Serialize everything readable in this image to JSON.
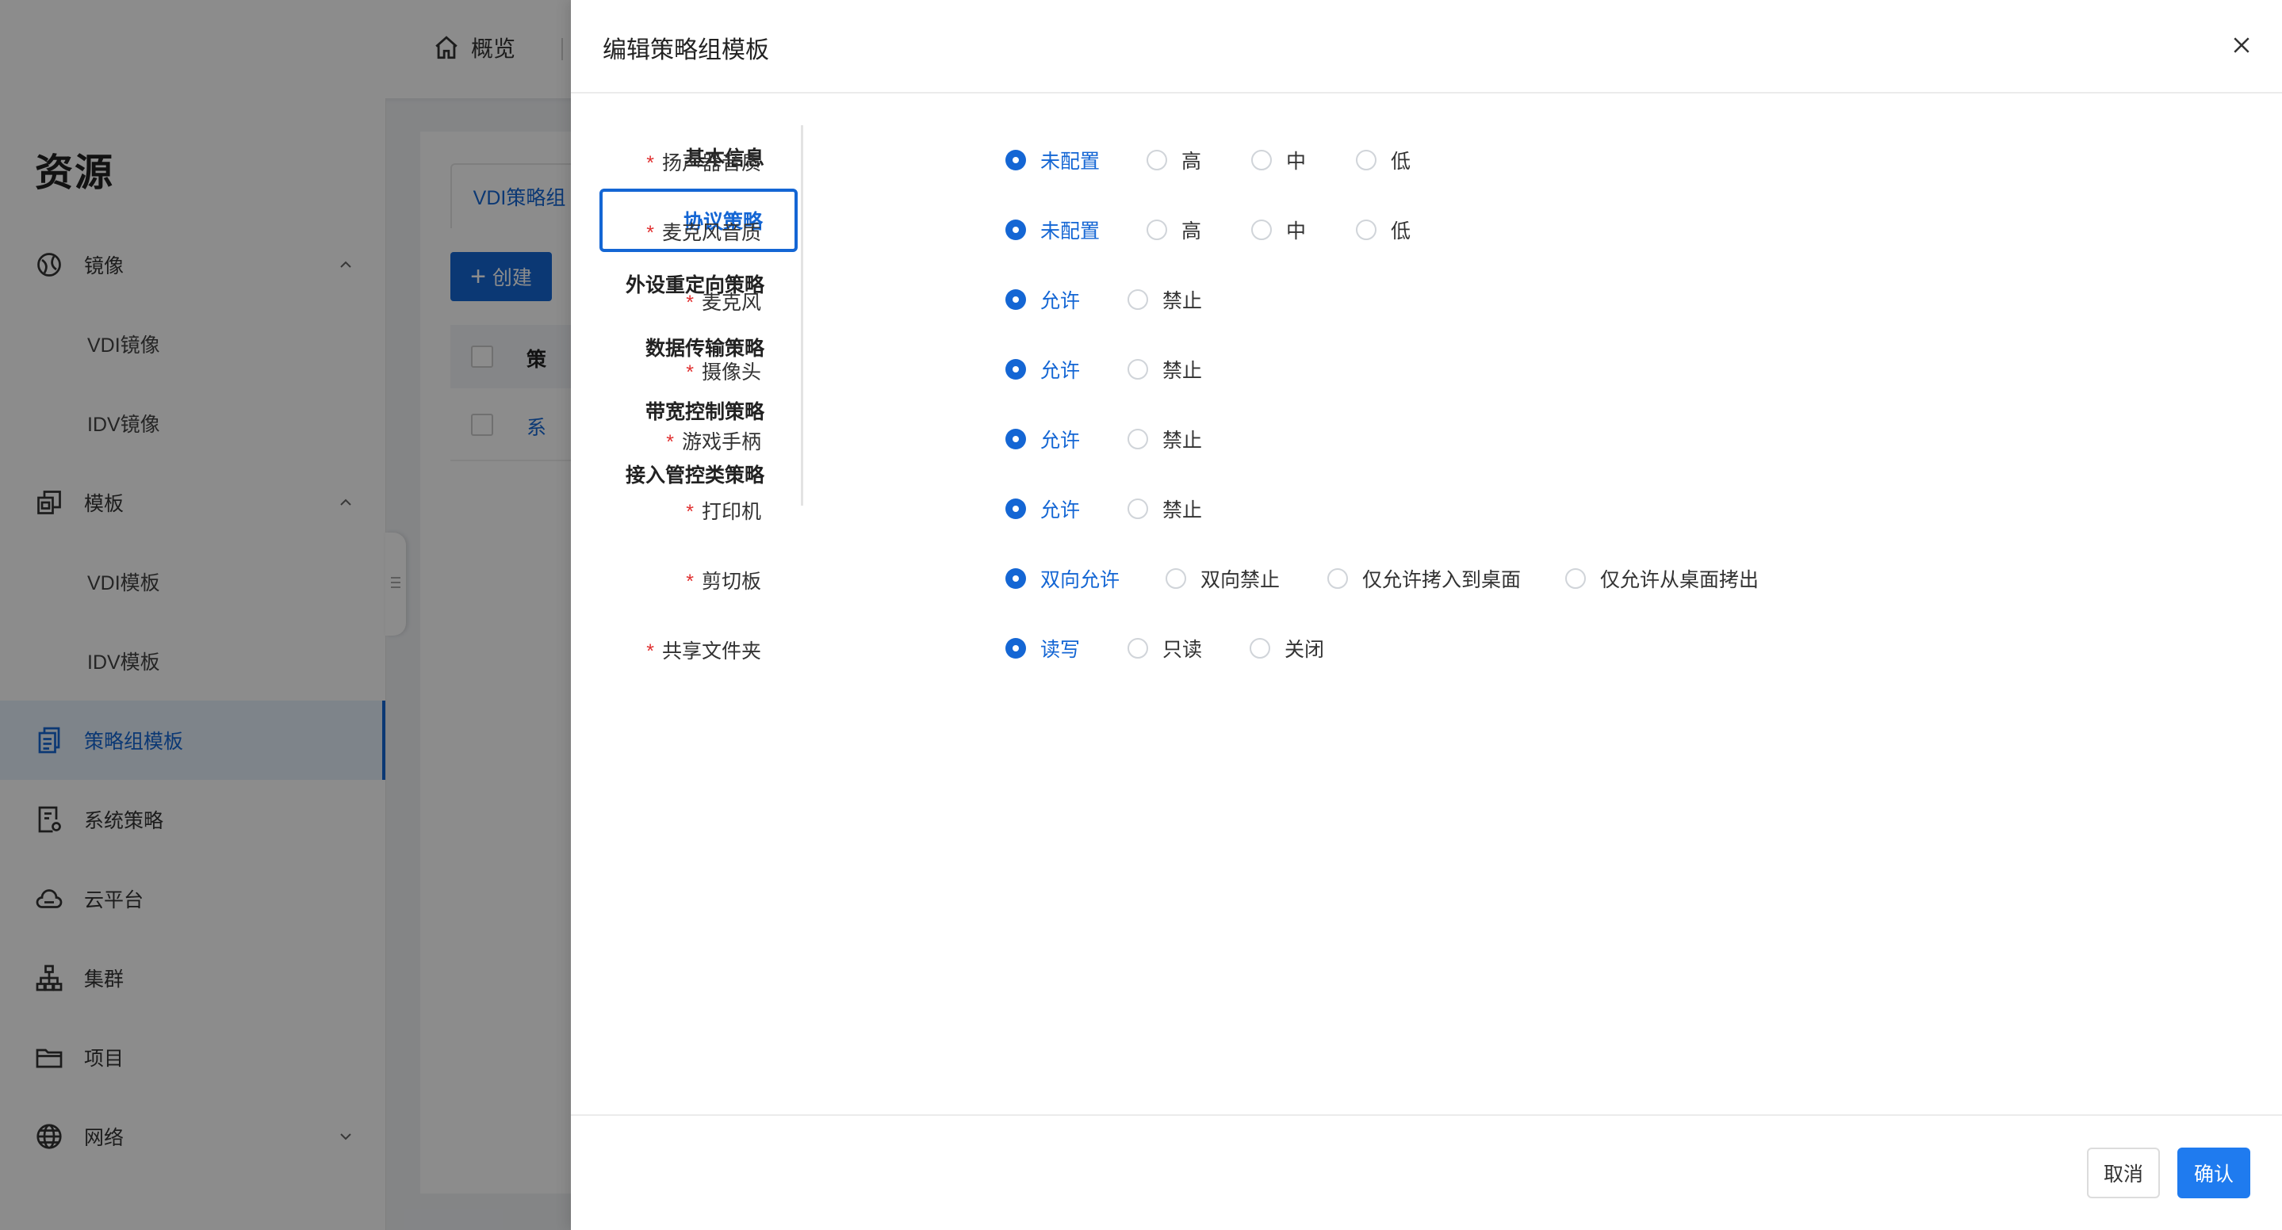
{
  "header": {
    "overview_label": "概览"
  },
  "sidebar": {
    "title": "资源",
    "items": [
      {
        "label": "镜像",
        "icon": "image-icon",
        "expanded": true,
        "children": [
          "VDI镜像",
          "IDV镜像"
        ]
      },
      {
        "label": "模板",
        "icon": "template-icon",
        "expanded": true,
        "children": [
          "VDI模板",
          "IDV模板"
        ]
      },
      {
        "label": "策略组模板",
        "icon": "policy-doc-icon",
        "active": true
      },
      {
        "label": "系统策略",
        "icon": "system-policy-icon"
      },
      {
        "label": "云平台",
        "icon": "cloud-icon"
      },
      {
        "label": "集群",
        "icon": "cluster-icon"
      },
      {
        "label": "项目",
        "icon": "folder-icon"
      },
      {
        "label": "网络",
        "icon": "globe-icon",
        "expanded": false
      }
    ]
  },
  "content": {
    "tab_label": "VDI策略组",
    "create_label": "创建",
    "header_text": "策",
    "row_text": "系"
  },
  "drawer": {
    "title": "编辑策略组模板",
    "nav": [
      {
        "label": "基本信息"
      },
      {
        "label": "协议策略",
        "active": true
      },
      {
        "label": "外设重定向策略"
      },
      {
        "label": "数据传输策略"
      },
      {
        "label": "带宽控制策略"
      },
      {
        "label": "接入管控类策略"
      }
    ],
    "form": [
      {
        "label": "扬声器音质",
        "required": true,
        "options": [
          "未配置",
          "高",
          "中",
          "低"
        ],
        "selected": 0
      },
      {
        "label": "麦克风音质",
        "required": true,
        "options": [
          "未配置",
          "高",
          "中",
          "低"
        ],
        "selected": 0
      },
      {
        "label": "麦克风",
        "required": true,
        "options": [
          "允许",
          "禁止"
        ],
        "selected": 0
      },
      {
        "label": "摄像头",
        "required": true,
        "options": [
          "允许",
          "禁止"
        ],
        "selected": 0
      },
      {
        "label": "游戏手柄",
        "required": true,
        "options": [
          "允许",
          "禁止"
        ],
        "selected": 0
      },
      {
        "label": "打印机",
        "required": true,
        "options": [
          "允许",
          "禁止"
        ],
        "selected": 0
      },
      {
        "label": "剪切板",
        "required": true,
        "options": [
          "双向允许",
          "双向禁止",
          "仅允许拷入到桌面",
          "仅允许从桌面拷出"
        ],
        "selected": 0
      },
      {
        "label": "共享文件夹",
        "required": true,
        "options": [
          "读写",
          "只读",
          "关闭"
        ],
        "selected": 0
      }
    ],
    "cancel_label": "取消",
    "confirm_label": "确认"
  },
  "colors": {
    "primary": "#1466d4",
    "confirm_button": "#1f7bef",
    "required_mark": "#e03131",
    "overlay": "rgba(0,0,0,0.45)"
  }
}
